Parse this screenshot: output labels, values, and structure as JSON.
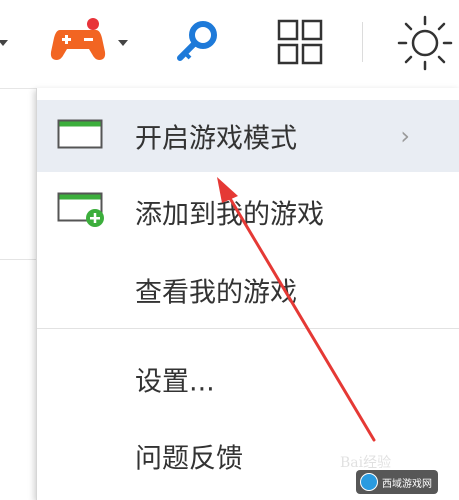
{
  "toolbar": {
    "icons": [
      "chevron-down-icon",
      "game-controller-icon",
      "chevron-down-icon",
      "key-icon",
      "grid-icon",
      "brightness-icon"
    ],
    "colors": {
      "controller": "#f26522",
      "badge": "#e8333a",
      "key": "#1e7ad9"
    }
  },
  "menu": {
    "items": [
      {
        "label": "开启游戏模式",
        "icon": "window-icon",
        "has_submenu": true,
        "highlighted": true
      },
      {
        "label": "添加到我的游戏",
        "icon": "window-add-icon",
        "has_submenu": false,
        "highlighted": false
      },
      {
        "label": "查看我的游戏",
        "icon": "",
        "has_submenu": false,
        "highlighted": false
      },
      {
        "label": "设置...",
        "icon": "",
        "has_submenu": false,
        "highlighted": false
      },
      {
        "label": "问题反馈",
        "icon": "",
        "has_submenu": false,
        "highlighted": false
      }
    ],
    "submenu_glyph": "›"
  },
  "annotation": {
    "type": "arrow",
    "color": "#e53935"
  },
  "watermarks": {
    "top": "Bai经验",
    "badge": "西域游戏网"
  }
}
